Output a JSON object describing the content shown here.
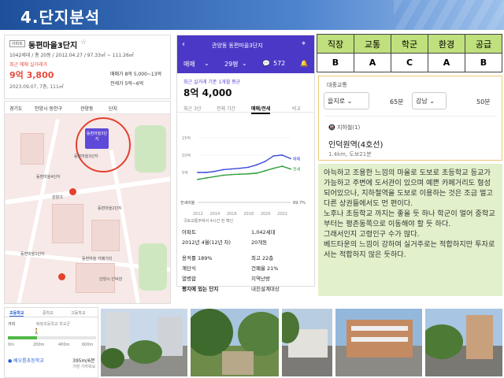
{
  "header": {
    "title": "4.단지분석"
  },
  "listing": {
    "tag": "아파트",
    "name": "동편마을3단지",
    "meta": "1042세대 / 총 20동 / 2012.04.27 / 97.33㎡ ~ 111.26㎡",
    "recent_label": "최근 매매 실거래가",
    "recent_price": "9억 3,800",
    "recent_date": "2023.09.07, 7층, 111㎡",
    "sale_range": "매매가 8억 5,000~13억",
    "jeonse_range": "전세가 5억~6억"
  },
  "map": {
    "filters": [
      "경기도",
      "안양시 동안구",
      "관양동",
      "단지"
    ],
    "pin_label": "동편마을3단지",
    "labels": [
      "동편마을3단지",
      "동편마을4단지",
      "관양고",
      "동편마을2단지",
      "동편마을 카페거리",
      "동편마을1단지",
      "안양시 인덕원"
    ]
  },
  "school": {
    "tabs": [
      "초등학교",
      "중학교",
      "고등학교"
    ],
    "distance_label": "거리",
    "option_label": "배정초등학교 학교군",
    "walk_fraction": 0.33,
    "ticks": [
      "0m",
      "200m",
      "400m",
      "600m"
    ],
    "school_name": "● 배오름초등학교",
    "school_distance": "395m/6분",
    "school_sub": "가장 가까워요"
  },
  "app": {
    "title": "관양동 동편마을3단지",
    "type": "매매",
    "size": "29평",
    "comments": "572",
    "avg_label": "최근 실거래 기준 1개월 평균",
    "avg_price": "8억 4,000",
    "tabs": [
      "최근 3년",
      "전체 기간",
      "매매/전세",
      "비교"
    ],
    "source": "국토교통부에서 4시간 전 확인",
    "facts_left": [
      "아파트",
      "2012년 4월(12년 차)",
      "용적률 189%",
      "계단식",
      "열병합",
      "평지에 있는 단지"
    ],
    "facts_right": [
      "1,042세대",
      "20개동",
      "최고 22층",
      "건폐율 21%",
      "지역난방",
      "내진설계대상"
    ]
  },
  "chart_data": {
    "type": "line",
    "x": [
      2012,
      2013,
      2014,
      2015,
      2016,
      2017,
      2018,
      2019,
      2020,
      2021,
      2022,
      2023
    ],
    "series": [
      {
        "name": "매매",
        "values": [
          5.0,
          5.0,
          5.3,
          5.8,
          6.0,
          6.2,
          6.5,
          7.2,
          8.2,
          9.8,
          10.0,
          9.0
        ]
      },
      {
        "name": "전세",
        "values": [
          3.0,
          3.4,
          3.8,
          4.2,
          4.4,
          4.5,
          4.6,
          4.8,
          5.5,
          6.2,
          6.8,
          6.0
        ]
      }
    ],
    "jeonse_ratio_label": "전세비율",
    "jeonse_ratio_value": "69.7%",
    "y_ticks": [
      "15억",
      "10억",
      "5억"
    ],
    "x_ticks": [
      "2012",
      "2014",
      "2016",
      "2018",
      "2020",
      "2022"
    ],
    "ylim": [
      0,
      15
    ],
    "colors": {
      "sale": "#3b4bd8",
      "jeonse": "#2e9e3a"
    }
  },
  "ratings": {
    "headers": [
      "직장",
      "교통",
      "학군",
      "환경",
      "공급"
    ],
    "values": [
      "B",
      "A",
      "C",
      "A",
      "B"
    ]
  },
  "transit": {
    "caption": "대중교통",
    "dest1": "을지로",
    "min1": "65분",
    "dest2": "강남",
    "min2": "50분",
    "subway_label": "지하철(1)",
    "station": "인덕원역(4호선)",
    "station_distance": "1.4km, 도보21분"
  },
  "description": [
    "아늑하고 조용한 느낌의 마을로 도보로 초등학교 등교가 가능하고 주변에 도서관이 있으며 예쁜 카페거리도 형성되어있으나, 지하철역을 도보로 이용하는 것은 조금 멀고 다른 상권들에서도 먼 편이다.",
    "노후나 초등학교 까지는 좋을 듯 하나 학군이 멀어 중학교부터는 평촌동쪽으로 이동해야 할 듯 하다.",
    "그래서인지 고령인구 수가 많다.",
    "베드타운의 느낌이 강하여 실거주로는 적합하지만 투자로서는 적합하지 않은 듯하다."
  ]
}
